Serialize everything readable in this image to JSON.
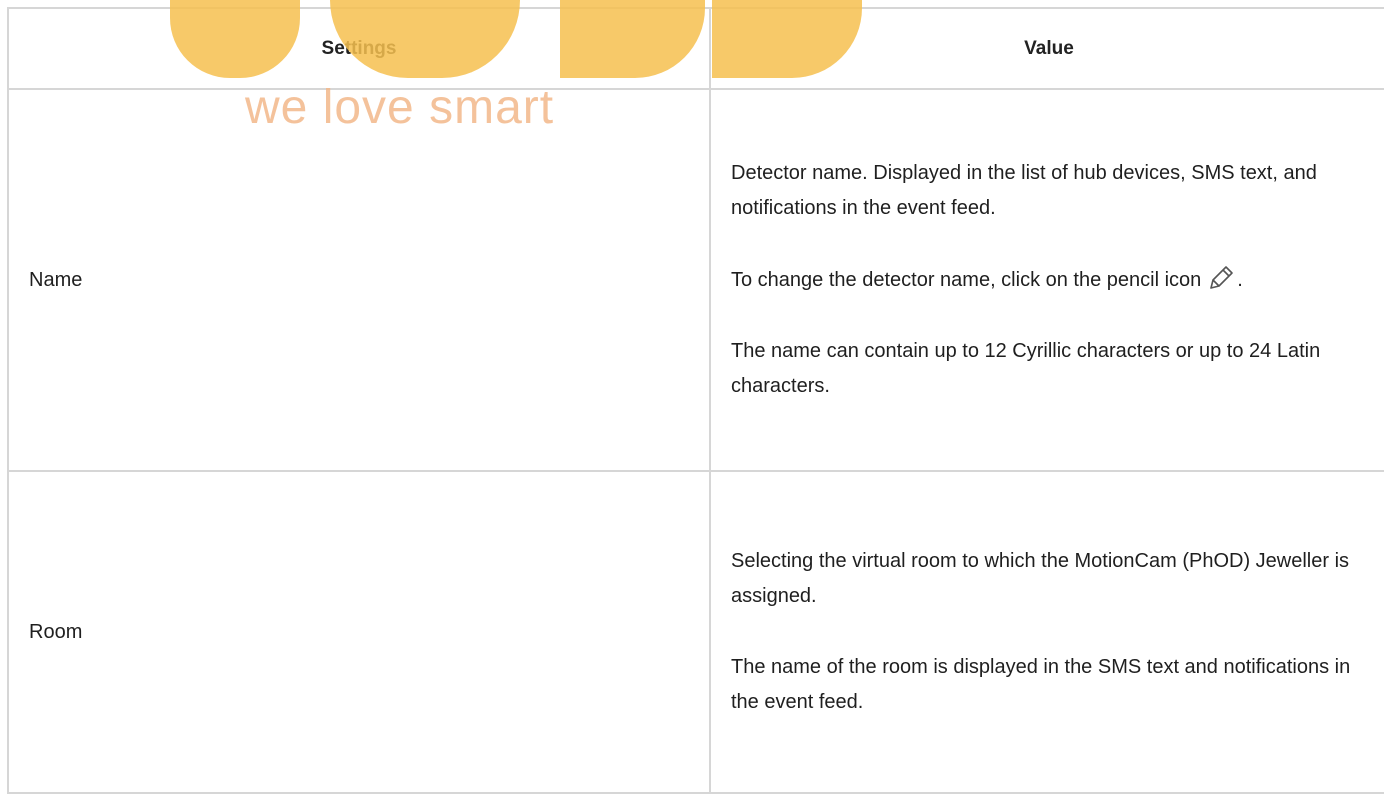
{
  "table": {
    "headers": {
      "settings": "Settings",
      "value": "Value"
    },
    "rows": [
      {
        "setting": "Name",
        "paragraphs": [
          "Detector name. Displayed in the list of hub devices, SMS text, and notifications in the event feed.",
          "To change the detector name, click on the pencil icon",
          "The name can contain up to 12 Cyrillic characters or up to 24 Latin characters."
        ],
        "icon_suffix": "."
      },
      {
        "setting": "Room",
        "paragraphs": [
          "Selecting the virtual room to which the MotionCam (PhOD) Jeweller is assigned.",
          "The name of the room is displayed in the SMS text and notifications in the event feed."
        ]
      }
    ]
  },
  "watermark": {
    "tagline": "we love smart"
  },
  "colors": {
    "border": "#d6d6d6",
    "watermark": "#f6c04f",
    "text": "#1f1f1f"
  },
  "icons": {
    "pencil": "pencil-icon"
  }
}
